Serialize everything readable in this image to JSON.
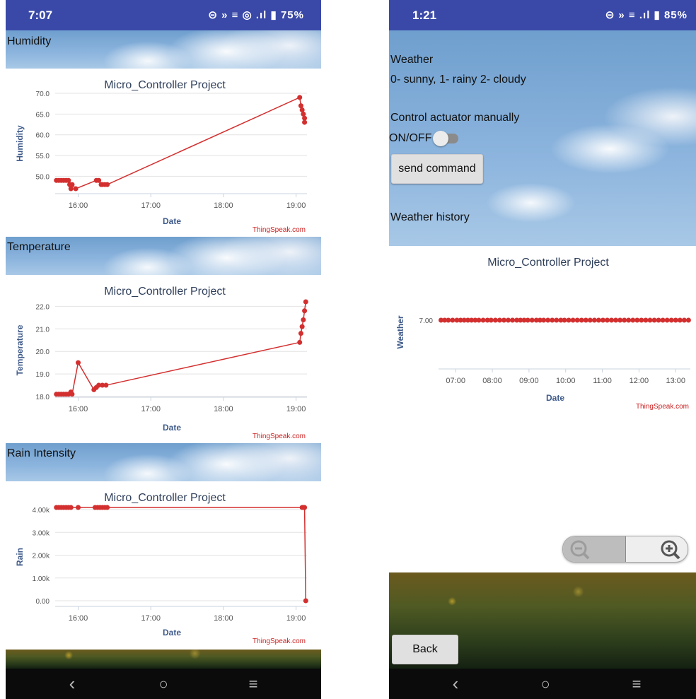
{
  "left": {
    "status": {
      "time": "7:07",
      "icons": "⊝ » ≡ ◎ .ıl",
      "battery": "75%"
    },
    "sections": [
      {
        "label": "Humidity"
      },
      {
        "label": "Temperature"
      },
      {
        "label": "Rain Intensity"
      }
    ]
  },
  "right": {
    "status": {
      "time": "1:21",
      "icons": "⊝ » ≡ .ıl",
      "battery": "85%"
    },
    "weather_title": "Weather",
    "weather_legend": "0- sunny, 1- rainy 2- cloudy",
    "control_label": "Control actuator manually",
    "toggle_label": "ON/OFF",
    "send_button": "send command",
    "history_label": "Weather history",
    "back_button": "Back",
    "zoom_out_icon": "zoom-out-icon",
    "zoom_in_icon": "zoom-in-icon"
  },
  "colors": {
    "series": "#d32f2f",
    "axis_text": "#555555",
    "title": "#333333",
    "axis_title": "#3e5a8a",
    "credit": "#cc1f1f",
    "header": "#3a49a8"
  },
  "chart_data": [
    {
      "type": "line",
      "title": "Micro_Controller Project",
      "ylabel": "Humidity",
      "xlabel": "Date",
      "credit": "ThingSpeak.com",
      "yticks": [
        "50.0",
        "55.0",
        "60.0",
        "65.0",
        "70.0"
      ],
      "xticks": [
        "16:00",
        "17:00",
        "18:00",
        "19:00"
      ],
      "ylim": [
        47,
        70
      ],
      "xlim": [
        "15:41",
        "19:09"
      ],
      "x": [
        "15:42",
        "15:44",
        "15:46",
        "15:48",
        "15:50",
        "15:52",
        "15:53",
        "15:54",
        "15:55",
        "15:58",
        "16:15",
        "16:17",
        "16:19",
        "16:20",
        "16:22",
        "16:24",
        "19:03",
        "19:04",
        "19:05",
        "19:06",
        "19:07"
      ],
      "y": [
        49,
        49,
        49,
        49,
        49,
        49,
        48,
        47,
        48,
        47,
        49,
        49,
        48,
        48,
        48,
        48,
        69,
        67,
        66,
        65,
        64,
        63
      ]
    },
    {
      "type": "line",
      "title": "Micro_Controller Project",
      "ylabel": "Temperature",
      "xlabel": "Date",
      "credit": "ThingSpeak.com",
      "yticks": [
        "18.0",
        "19.0",
        "20.0",
        "21.0",
        "22.0"
      ],
      "xticks": [
        "16:00",
        "17:00",
        "18:00",
        "19:00"
      ],
      "ylim": [
        18,
        22.2
      ],
      "xlim": [
        "15:41",
        "19:09"
      ],
      "x": [
        "15:42",
        "15:44",
        "15:46",
        "15:48",
        "15:50",
        "15:52",
        "15:54",
        "15:55",
        "16:00",
        "16:13",
        "16:15",
        "16:17",
        "16:20",
        "16:23",
        "19:03",
        "19:04",
        "19:05",
        "19:06",
        "19:07",
        "19:08"
      ],
      "y": [
        18.1,
        18.1,
        18.1,
        18.1,
        18.1,
        18.1,
        18.2,
        18.1,
        19.5,
        18.3,
        18.4,
        18.5,
        18.5,
        18.5,
        20.4,
        20.8,
        21.1,
        21.4,
        21.8,
        22.2
      ]
    },
    {
      "type": "line",
      "title": "Micro_Controller Project",
      "ylabel": "Rain",
      "xlabel": "Date",
      "credit": "ThingSpeak.com",
      "yticks": [
        "0.00",
        "1.00k",
        "2.00k",
        "3.00k",
        "4.00k"
      ],
      "xticks": [
        "16:00",
        "17:00",
        "18:00",
        "19:00"
      ],
      "ylim": [
        0,
        4095
      ],
      "xlim": [
        "15:41",
        "19:09"
      ],
      "x": [
        "15:42",
        "15:44",
        "15:46",
        "15:48",
        "15:50",
        "15:52",
        "15:54",
        "16:00",
        "16:14",
        "16:16",
        "16:18",
        "16:20",
        "16:22",
        "16:24",
        "19:05",
        "19:06",
        "19:07",
        "19:08"
      ],
      "y": [
        4095,
        4095,
        4095,
        4095,
        4095,
        4095,
        4095,
        4095,
        4095,
        4095,
        4095,
        4095,
        4095,
        4095,
        4095,
        4095,
        4095,
        0
      ]
    },
    {
      "type": "line",
      "title": "Micro_Controller Project",
      "ylabel": "Weather",
      "xlabel": "Date",
      "credit": "ThingSpeak.com",
      "yticks": [
        "7.00"
      ],
      "xticks": [
        "07:00",
        "08:00",
        "09:00",
        "10:00",
        "11:00",
        "12:00",
        "13:00"
      ],
      "ylim": [
        7,
        7
      ],
      "xlim": [
        "06:32",
        "13:24"
      ],
      "x": [
        "06:36",
        "06:42",
        "06:48",
        "06:55",
        "07:02",
        "07:08",
        "07:14",
        "07:20",
        "07:26",
        "07:32",
        "07:38",
        "07:45",
        "07:52",
        "07:58",
        "08:05",
        "08:12",
        "08:19",
        "08:26",
        "08:33",
        "08:40",
        "08:46",
        "08:52",
        "08:58",
        "09:05",
        "09:12",
        "09:18",
        "09:24",
        "09:31",
        "09:38",
        "09:45",
        "09:52",
        "09:58",
        "10:05",
        "10:12",
        "10:19",
        "10:26",
        "10:33",
        "10:40",
        "10:47",
        "10:54",
        "11:01",
        "11:08",
        "11:15",
        "11:22",
        "11:29",
        "11:36",
        "11:43",
        "11:50",
        "11:57",
        "12:04",
        "12:11",
        "12:18",
        "12:25",
        "12:32",
        "12:39",
        "12:46",
        "12:53",
        "13:00",
        "13:07",
        "13:14",
        "13:21"
      ],
      "y": [
        7,
        7,
        7,
        7,
        7,
        7,
        7,
        7,
        7,
        7,
        7,
        7,
        7,
        7,
        7,
        7,
        7,
        7,
        7,
        7,
        7,
        7,
        7,
        7,
        7,
        7,
        7,
        7,
        7,
        7,
        7,
        7,
        7,
        7,
        7,
        7,
        7,
        7,
        7,
        7,
        7,
        7,
        7,
        7,
        7,
        7,
        7,
        7,
        7,
        7,
        7,
        7,
        7,
        7,
        7,
        7,
        7,
        7,
        7,
        7,
        7
      ]
    }
  ]
}
